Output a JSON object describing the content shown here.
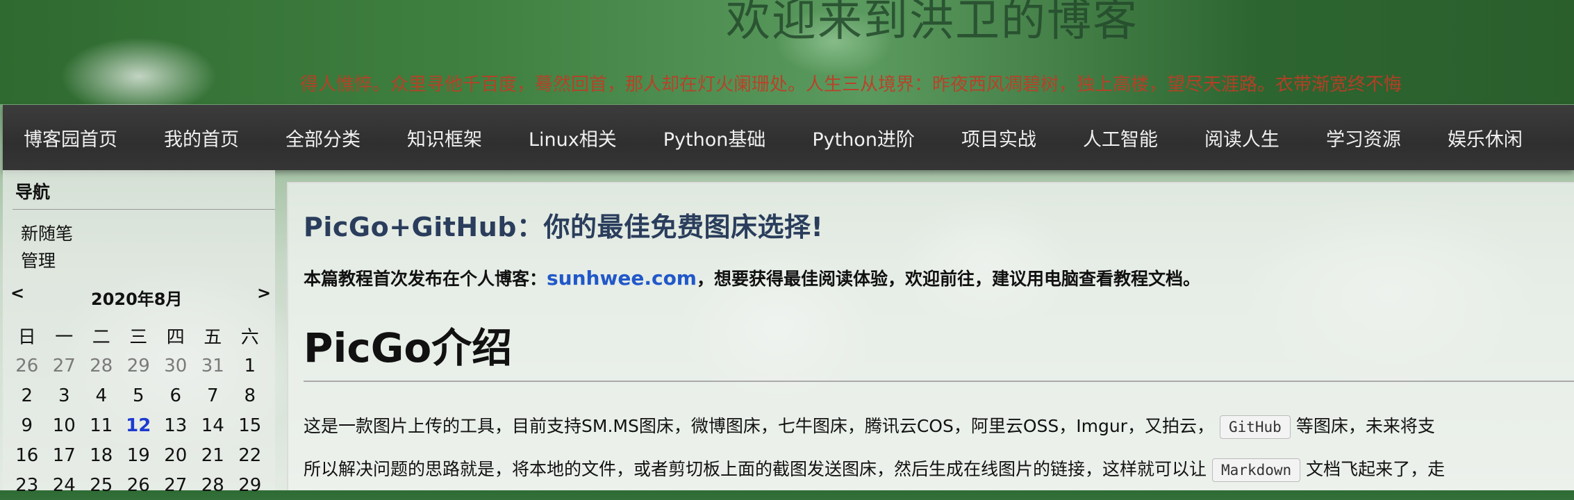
{
  "header": {
    "title": "欢迎来到洪卫的博客",
    "subtitle": "得人憔悴。众里寻他千百度，蓦然回首，那人却在灯火阑珊处。人生三从境界：昨夜西风凋碧树，独上高楼，望尽天涯路。衣带渐宽终不悔"
  },
  "nav": {
    "items": [
      {
        "label": "博客园首页"
      },
      {
        "label": "我的首页"
      },
      {
        "label": "全部分类"
      },
      {
        "label": "知识框架"
      },
      {
        "label": "Linux相关"
      },
      {
        "label": "Python基础"
      },
      {
        "label": "Python进阶"
      },
      {
        "label": "项目实战"
      },
      {
        "label": "人工智能"
      },
      {
        "label": "阅读人生"
      },
      {
        "label": "学习资源"
      },
      {
        "label": "娱乐休闲"
      }
    ]
  },
  "sidebar": {
    "heading": "导航",
    "links": [
      "新随笔",
      "管理"
    ],
    "calendar": {
      "prev": "<",
      "next": ">",
      "title": "2020年8月",
      "weekdays": [
        "日",
        "一",
        "二",
        "三",
        "四",
        "五",
        "六"
      ],
      "weeks": [
        [
          "26",
          "27",
          "28",
          "29",
          "30",
          "31",
          "1"
        ],
        [
          "2",
          "3",
          "4",
          "5",
          "6",
          "7",
          "8"
        ],
        [
          "9",
          "10",
          "11",
          "12",
          "13",
          "14",
          "15"
        ],
        [
          "16",
          "17",
          "18",
          "19",
          "20",
          "21",
          "22"
        ],
        [
          "23",
          "24",
          "25",
          "26",
          "27",
          "28",
          "29"
        ]
      ],
      "today": "12"
    }
  },
  "post": {
    "title_part1": "PicGo+GitHub",
    "title_sep": "：",
    "title_part2": "你的最佳免费图床选择!",
    "intro_before": "本篇教程首次发布在个人博客：",
    "intro_link": "sunhwee.com",
    "intro_after": "，想要获得最佳阅读体验，欢迎前往，建议用电脑查看教程文档。",
    "h1": "PicGo介绍",
    "para1_before": "这是一款图片上传的工具，目前支持SM.MS图床，微博图床，七牛图床，腾讯云COS，阿里云OSS，Imgur，又拍云，",
    "para1_code": "GitHub",
    "para1_after": "等图床，未来将支",
    "para2_before": "所以解决问题的思路就是，将本地的文件，或者剪切板上面的截图发送图床，然后生成在线图片的链接，这样就可以让",
    "para2_code": "Markdown",
    "para2_after": "文档飞起来了，走"
  },
  "colors": {
    "nav_bg": "#333333",
    "subtitle": "#c23b25",
    "title_blue": "#2a3d5c",
    "link": "#2158c9",
    "today": "#1d3bd1"
  }
}
